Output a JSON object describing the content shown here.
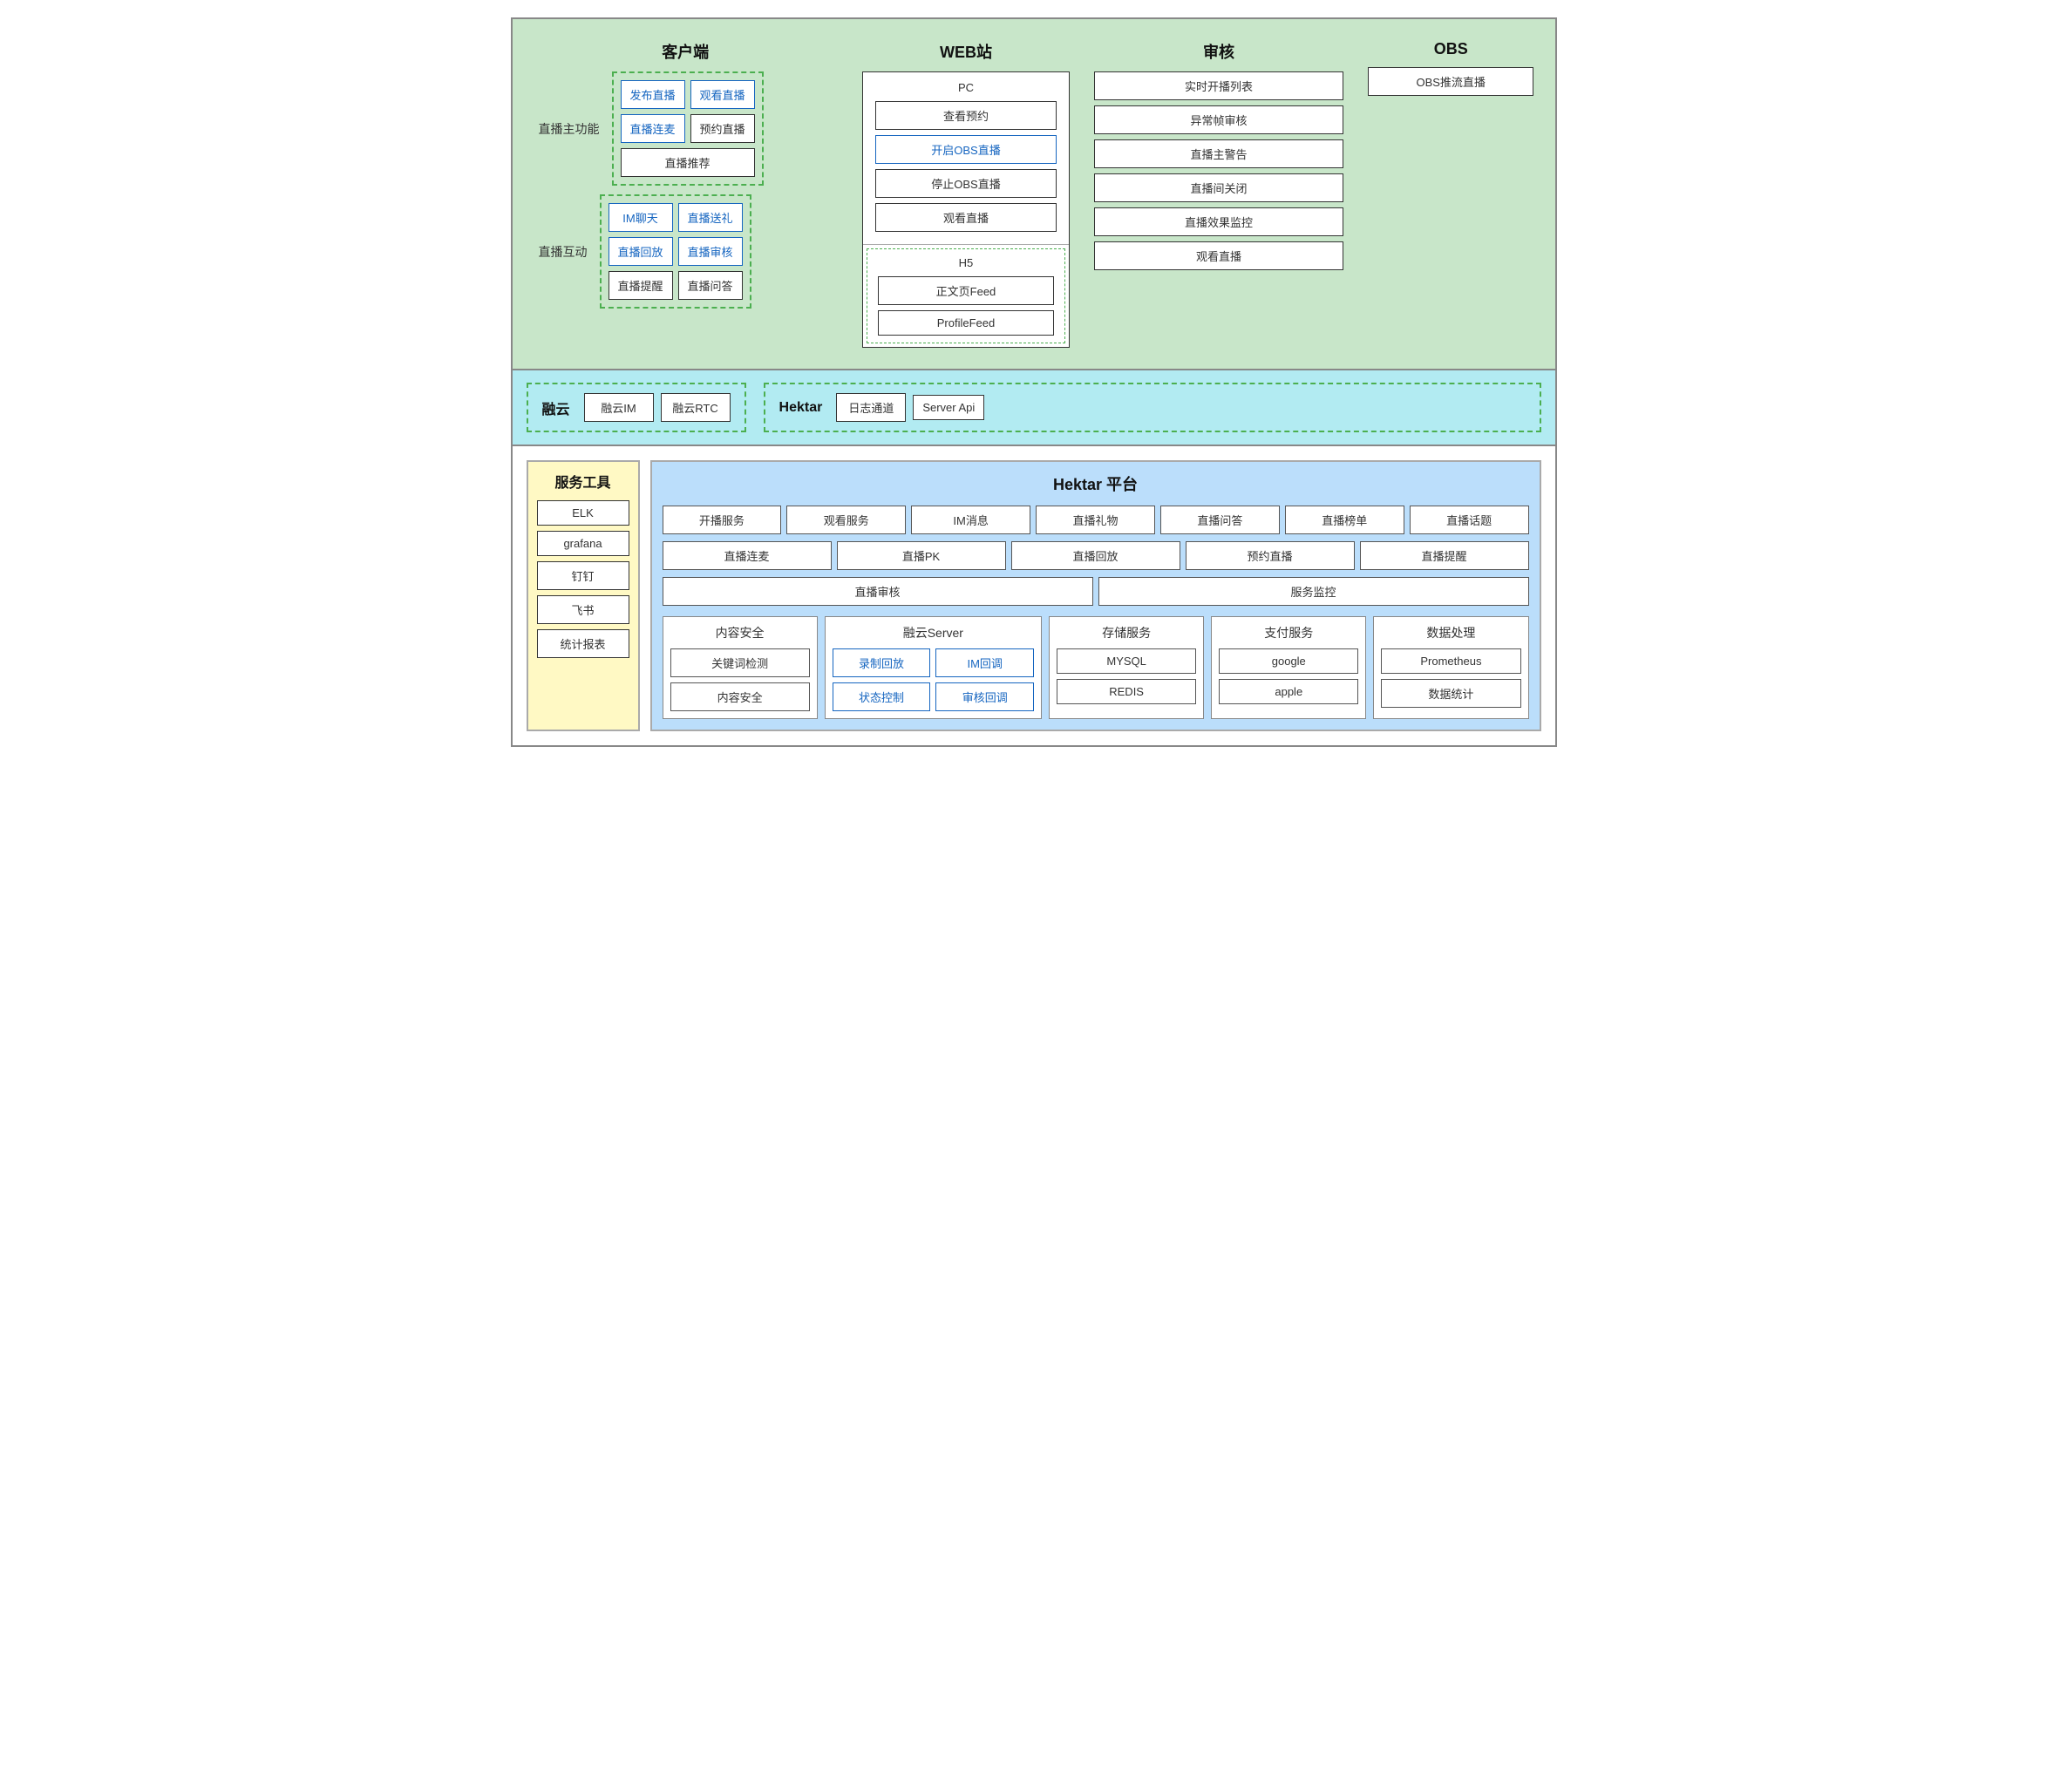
{
  "top": {
    "title_client": "客户端",
    "title_web": "WEB站",
    "title_audit": "审核",
    "title_obs": "OBS",
    "client": {
      "label_main": "直播主功能",
      "label_interact": "直播互动",
      "main_cells": [
        {
          "text": "发布直播",
          "blue": true
        },
        {
          "text": "观看直播",
          "blue": true
        },
        {
          "text": "直播连麦",
          "blue": true
        },
        {
          "text": "预约直播",
          "blue": false
        },
        {
          "text": "直播推荐",
          "blue": false,
          "span": true
        }
      ],
      "interact_cells": [
        {
          "text": "IM聊天",
          "blue": true
        },
        {
          "text": "直播送礼",
          "blue": true
        },
        {
          "text": "直播回放",
          "blue": true
        },
        {
          "text": "直播审核",
          "blue": true
        },
        {
          "text": "直播提醒",
          "blue": false
        },
        {
          "text": "直播问答",
          "blue": false
        }
      ]
    },
    "web": {
      "pc_title": "PC",
      "pc_cells": [
        {
          "text": "查看预约",
          "blue": false
        },
        {
          "text": "开启OBS直播",
          "blue": true
        },
        {
          "text": "停止OBS直播",
          "blue": false
        },
        {
          "text": "观看直播",
          "blue": false
        }
      ],
      "h5_title": "H5",
      "h5_cells": [
        {
          "text": "正文页Feed",
          "blue": false
        },
        {
          "text": "ProfileFeed",
          "blue": false
        }
      ]
    },
    "audit": {
      "cells": [
        "实时开播列表",
        "异常帧审核",
        "直播主警告",
        "直播间关闭",
        "直播效果监控",
        "观看直播"
      ]
    },
    "obs": {
      "cell": "OBS推流直播"
    }
  },
  "middle": {
    "rongcloud_title": "融云",
    "rongcloud_cells": [
      "融云IM",
      "融云RTC"
    ],
    "hektar_title": "Hektar",
    "hektar_cells": [
      "日志通道",
      "Server Api"
    ]
  },
  "bottom": {
    "tools_title": "服务工具",
    "tools_cells": [
      "ELK",
      "grafana",
      "钉钉",
      "飞书",
      "统计报表"
    ],
    "platform_title": "Hektar 平台",
    "platform_row1": [
      "开播服务",
      "观看服务",
      "IM消息",
      "直播礼物",
      "直播问答",
      "直播榜单",
      "直播话题"
    ],
    "platform_row2": [
      "直播连麦",
      "直播PK",
      "直播回放",
      "预约直播",
      "直播提醒"
    ],
    "platform_row3": [
      "直播审核",
      "服务监控"
    ],
    "services": {
      "content_safety": {
        "title": "内容安全",
        "cells": [
          "关键词检测",
          "内容安全"
        ]
      },
      "rongcloud_server": {
        "title": "融云Server",
        "cells_row1": [
          {
            "text": "录制回放",
            "blue": true
          },
          {
            "text": "IM回调",
            "blue": true
          }
        ],
        "cells_row2": [
          {
            "text": "状态控制",
            "blue": true
          },
          {
            "text": "审核回调",
            "blue": true
          }
        ]
      },
      "storage": {
        "title": "存储服务",
        "cells": [
          "MYSQL",
          "REDIS"
        ]
      },
      "payment": {
        "title": "支付服务",
        "cells": [
          "google",
          "apple"
        ]
      },
      "data_processing": {
        "title": "数据处理",
        "cells": [
          "Prometheus",
          "数据统计"
        ]
      }
    }
  }
}
